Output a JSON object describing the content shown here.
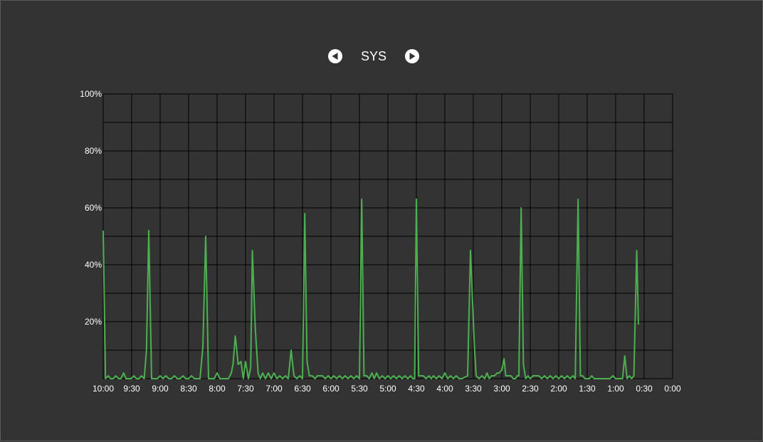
{
  "header": {
    "title": "SYS",
    "prev_icon": "prev-arrow-icon",
    "next_icon": "next-arrow-icon"
  },
  "colors": {
    "background": "#333333",
    "grid": "#000000",
    "line": "#4caf50",
    "text": "#ffffff"
  },
  "chart_data": {
    "type": "line",
    "title": "SYS",
    "xlabel": "",
    "ylabel": "",
    "ylim": [
      0,
      100
    ],
    "yticks": [
      "",
      "20%",
      "40%",
      "60%",
      "80%",
      "100%"
    ],
    "xticks": [
      "10:00",
      "9:30",
      "9:00",
      "8:30",
      "8:00",
      "7:30",
      "7:00",
      "6:30",
      "6:00",
      "5:30",
      "5:00",
      "4:30",
      "4:00",
      "3:30",
      "3:00",
      "2:30",
      "2:00",
      "1:30",
      "1:00",
      "0:30",
      "0:00"
    ],
    "x_axis": "hours ago, from 10:00 at left to 0:00 at right",
    "grid": true,
    "legend": "none",
    "series": [
      {
        "points": [
          [
            10.0,
            52
          ],
          [
            9.96,
            0
          ],
          [
            9.91,
            1
          ],
          [
            9.87,
            0
          ],
          [
            9.82,
            0
          ],
          [
            9.78,
            1
          ],
          [
            9.73,
            0
          ],
          [
            9.69,
            0
          ],
          [
            9.64,
            2
          ],
          [
            9.6,
            0
          ],
          [
            9.55,
            0
          ],
          [
            9.51,
            0
          ],
          [
            9.46,
            1
          ],
          [
            9.42,
            0
          ],
          [
            9.37,
            0
          ],
          [
            9.33,
            1
          ],
          [
            9.28,
            0
          ],
          [
            9.24,
            10
          ],
          [
            9.2,
            52
          ],
          [
            9.15,
            0
          ],
          [
            9.1,
            0
          ],
          [
            9.05,
            0
          ],
          [
            9.0,
            1
          ],
          [
            8.95,
            0
          ],
          [
            8.9,
            1
          ],
          [
            8.85,
            0
          ],
          [
            8.8,
            0
          ],
          [
            8.75,
            1
          ],
          [
            8.7,
            0
          ],
          [
            8.65,
            0
          ],
          [
            8.6,
            1
          ],
          [
            8.55,
            0
          ],
          [
            8.5,
            0
          ],
          [
            8.45,
            1
          ],
          [
            8.4,
            0
          ],
          [
            8.35,
            0
          ],
          [
            8.3,
            0
          ],
          [
            8.25,
            11
          ],
          [
            8.2,
            50
          ],
          [
            8.15,
            0
          ],
          [
            8.1,
            0
          ],
          [
            8.05,
            0
          ],
          [
            8.0,
            2
          ],
          [
            7.95,
            0
          ],
          [
            7.9,
            0
          ],
          [
            7.85,
            0
          ],
          [
            7.8,
            0
          ],
          [
            7.75,
            2
          ],
          [
            7.72,
            5
          ],
          [
            7.68,
            15
          ],
          [
            7.63,
            5
          ],
          [
            7.58,
            6
          ],
          [
            7.54,
            0
          ],
          [
            7.5,
            6
          ],
          [
            7.45,
            0
          ],
          [
            7.41,
            4
          ],
          [
            7.38,
            45
          ],
          [
            7.33,
            18
          ],
          [
            7.28,
            2
          ],
          [
            7.24,
            0
          ],
          [
            7.2,
            2
          ],
          [
            7.15,
            0
          ],
          [
            7.1,
            2
          ],
          [
            7.05,
            0
          ],
          [
            7.0,
            2
          ],
          [
            6.95,
            0
          ],
          [
            6.9,
            1
          ],
          [
            6.85,
            0
          ],
          [
            6.8,
            1
          ],
          [
            6.75,
            0
          ],
          [
            6.7,
            10
          ],
          [
            6.65,
            1
          ],
          [
            6.6,
            0
          ],
          [
            6.55,
            1
          ],
          [
            6.5,
            0
          ],
          [
            6.46,
            58
          ],
          [
            6.42,
            6
          ],
          [
            6.38,
            1
          ],
          [
            6.33,
            1
          ],
          [
            6.28,
            0
          ],
          [
            6.24,
            1
          ],
          [
            6.2,
            1
          ],
          [
            6.15,
            1
          ],
          [
            6.1,
            0
          ],
          [
            6.05,
            1
          ],
          [
            6.0,
            0
          ],
          [
            5.95,
            1
          ],
          [
            5.9,
            0
          ],
          [
            5.85,
            1
          ],
          [
            5.8,
            0
          ],
          [
            5.75,
            1
          ],
          [
            5.7,
            0
          ],
          [
            5.65,
            1
          ],
          [
            5.6,
            0
          ],
          [
            5.55,
            1
          ],
          [
            5.5,
            0
          ],
          [
            5.46,
            63
          ],
          [
            5.42,
            1
          ],
          [
            5.37,
            1
          ],
          [
            5.33,
            0
          ],
          [
            5.28,
            2
          ],
          [
            5.24,
            0
          ],
          [
            5.2,
            2
          ],
          [
            5.15,
            0
          ],
          [
            5.1,
            1
          ],
          [
            5.05,
            0
          ],
          [
            5.0,
            1
          ],
          [
            4.95,
            0
          ],
          [
            4.9,
            1
          ],
          [
            4.85,
            0
          ],
          [
            4.8,
            1
          ],
          [
            4.75,
            0
          ],
          [
            4.7,
            1
          ],
          [
            4.65,
            0
          ],
          [
            4.6,
            1
          ],
          [
            4.56,
            0
          ],
          [
            4.53,
            0
          ],
          [
            4.5,
            63
          ],
          [
            4.46,
            1
          ],
          [
            4.42,
            1
          ],
          [
            4.38,
            1
          ],
          [
            4.33,
            0
          ],
          [
            4.28,
            1
          ],
          [
            4.24,
            0
          ],
          [
            4.2,
            1
          ],
          [
            4.15,
            0
          ],
          [
            4.1,
            1
          ],
          [
            4.05,
            0
          ],
          [
            4.0,
            2
          ],
          [
            3.95,
            0
          ],
          [
            3.9,
            1
          ],
          [
            3.85,
            0
          ],
          [
            3.8,
            1
          ],
          [
            3.75,
            0
          ],
          [
            3.7,
            0
          ],
          [
            3.6,
            1
          ],
          [
            3.55,
            45
          ],
          [
            3.48,
            11
          ],
          [
            3.45,
            1
          ],
          [
            3.4,
            0
          ],
          [
            3.35,
            1
          ],
          [
            3.3,
            0
          ],
          [
            3.26,
            2
          ],
          [
            3.22,
            0
          ],
          [
            3.18,
            1
          ],
          [
            3.13,
            1
          ],
          [
            3.08,
            2
          ],
          [
            3.04,
            2
          ],
          [
            3.0,
            3
          ],
          [
            2.96,
            7
          ],
          [
            2.93,
            1
          ],
          [
            2.88,
            1
          ],
          [
            2.84,
            1
          ],
          [
            2.8,
            0
          ],
          [
            2.76,
            0
          ],
          [
            2.73,
            1
          ],
          [
            2.7,
            1
          ],
          [
            2.66,
            60
          ],
          [
            2.62,
            5
          ],
          [
            2.58,
            0
          ],
          [
            2.54,
            1
          ],
          [
            2.5,
            0
          ],
          [
            2.45,
            1
          ],
          [
            2.4,
            1
          ],
          [
            2.35,
            1
          ],
          [
            2.3,
            0
          ],
          [
            2.25,
            1
          ],
          [
            2.2,
            0
          ],
          [
            2.15,
            1
          ],
          [
            2.1,
            0
          ],
          [
            2.05,
            1
          ],
          [
            2.0,
            0
          ],
          [
            1.95,
            1
          ],
          [
            1.9,
            0
          ],
          [
            1.85,
            1
          ],
          [
            1.8,
            0
          ],
          [
            1.75,
            1
          ],
          [
            1.71,
            0
          ],
          [
            1.66,
            63
          ],
          [
            1.62,
            1
          ],
          [
            1.58,
            1
          ],
          [
            1.54,
            0
          ],
          [
            1.5,
            0
          ],
          [
            1.46,
            0
          ],
          [
            1.42,
            1
          ],
          [
            1.38,
            0
          ],
          [
            1.33,
            0
          ],
          [
            1.28,
            0
          ],
          [
            1.24,
            0
          ],
          [
            1.2,
            0
          ],
          [
            1.15,
            0
          ],
          [
            1.1,
            0
          ],
          [
            1.05,
            1
          ],
          [
            1.0,
            0
          ],
          [
            0.95,
            0
          ],
          [
            0.92,
            0
          ],
          [
            0.88,
            0
          ],
          [
            0.84,
            8
          ],
          [
            0.8,
            0
          ],
          [
            0.76,
            1
          ],
          [
            0.72,
            0
          ],
          [
            0.68,
            1
          ],
          [
            0.63,
            45
          ],
          [
            0.6,
            19
          ]
        ]
      }
    ]
  }
}
